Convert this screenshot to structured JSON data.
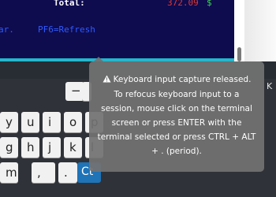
{
  "terminal": {
    "total_label": "Total:",
    "total_value": "372.09",
    "currency": "$",
    "prev_key_label": "ar.",
    "refresh_key_label": "PF6=Refresh",
    "colors": {
      "background": "#0e0b4f",
      "label": "#ffffff",
      "value": "#d73a3a",
      "currency": "#3fd15a",
      "key_hint": "#2e5bff",
      "status_line": "#23b7c9"
    }
  },
  "tooltip": {
    "icon": "warning-icon",
    "title": "Keyboard input capture released.",
    "message": "To refocus keyboard input to a session, mouse click on the terminal screen or press ENTER with the terminal selected or press CTRL + ALT + . (period)."
  },
  "keyboard": {
    "right_label": "K",
    "row1": [
      "y",
      "u",
      "i",
      "o",
      "p"
    ],
    "row2": [
      "g",
      "h",
      "j",
      "k",
      "l"
    ],
    "row3": [
      "m",
      ",",
      "."
    ],
    "minus_key": "−",
    "ctrl_key": "Ct",
    "ctrl_color": "#1f73b7"
  }
}
